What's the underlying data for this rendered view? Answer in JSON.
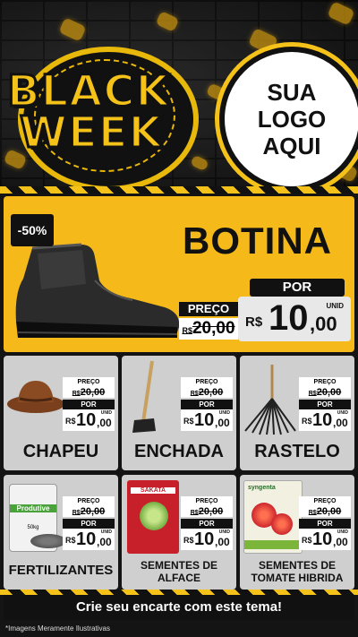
{
  "header": {
    "line1": "BLACK",
    "line2": "WEEK",
    "logo_lines": [
      "SUA",
      "LOGO",
      "AQUI"
    ]
  },
  "featured": {
    "discount": "-50%",
    "title": "BOTINA",
    "preco_label": "PREÇO",
    "old_currency": "R$",
    "old_price": "20,00",
    "por_label": "POR",
    "unid_label": "UNID",
    "new_currency": "R$",
    "new_int": "10",
    "new_cents": ",00"
  },
  "products": [
    {
      "name": "CHAPEU",
      "preco_label": "PREÇO",
      "old_currency": "R$",
      "old_price": "20,00",
      "por_label": "POR",
      "new_currency": "R$",
      "new_int": "10",
      "new_cents": ",00",
      "unid_label": "UNID"
    },
    {
      "name": "ENCHADA",
      "preco_label": "PREÇO",
      "old_currency": "R$",
      "old_price": "20,00",
      "por_label": "POR",
      "new_currency": "R$",
      "new_int": "10",
      "new_cents": ",00",
      "unid_label": "UNID"
    },
    {
      "name": "RASTELO",
      "preco_label": "PREÇO",
      "old_currency": "R$",
      "old_price": "20,00",
      "por_label": "POR",
      "new_currency": "R$",
      "new_int": "10",
      "new_cents": ",00",
      "unid_label": "UNID"
    },
    {
      "name": "FERTILIZANTES",
      "preco_label": "PREÇO",
      "old_currency": "R$",
      "old_price": "20,00",
      "por_label": "POR",
      "new_currency": "R$",
      "new_int": "10",
      "new_cents": ",00",
      "unid_label": "UNID"
    },
    {
      "name": "SEMENTES DE ALFACE",
      "preco_label": "PREÇO",
      "old_currency": "R$",
      "old_price": "20,00",
      "por_label": "POR",
      "new_currency": "R$",
      "new_int": "10",
      "new_cents": ",00",
      "unid_label": "UNID"
    },
    {
      "name": "SEMENTES DE TOMATE HIBRIDA",
      "preco_label": "PREÇO",
      "old_currency": "R$",
      "old_price": "20,00",
      "por_label": "POR",
      "new_currency": "R$",
      "new_int": "10",
      "new_cents": ",00",
      "unid_label": "UNID"
    }
  ],
  "package_text": {
    "fertilizer_brand": "Produtive",
    "fertilizer_weight": "50kg",
    "alface_brand": "SAKATA",
    "tomate_brand": "syngenta"
  },
  "footer": {
    "cta": "Crie seu encarte com este tema!",
    "note": "*Imagens Meramente Ilustrativas"
  },
  "colors": {
    "accent": "#f5b919",
    "dark": "#111111",
    "card": "#cfcfcf"
  }
}
